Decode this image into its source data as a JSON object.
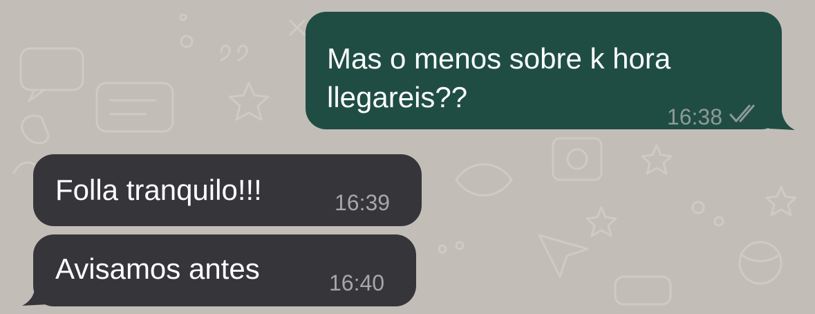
{
  "conversation": {
    "messages": [
      {
        "direction": "outgoing",
        "text": "Mas o menos sobre k hora\nllegareis??",
        "time": "16:38",
        "status_icon": "double-check-icon"
      },
      {
        "direction": "incoming",
        "text": "Folla tranquilo!!!",
        "time": "16:39"
      },
      {
        "direction": "incoming",
        "text": "Avisamos antes",
        "time": "16:40"
      }
    ]
  },
  "colors": {
    "background": "#c2beb7",
    "outgoing_bubble": "#1f4d44",
    "incoming_bubble": "#36363a",
    "timestamp": "#8f9a96"
  }
}
